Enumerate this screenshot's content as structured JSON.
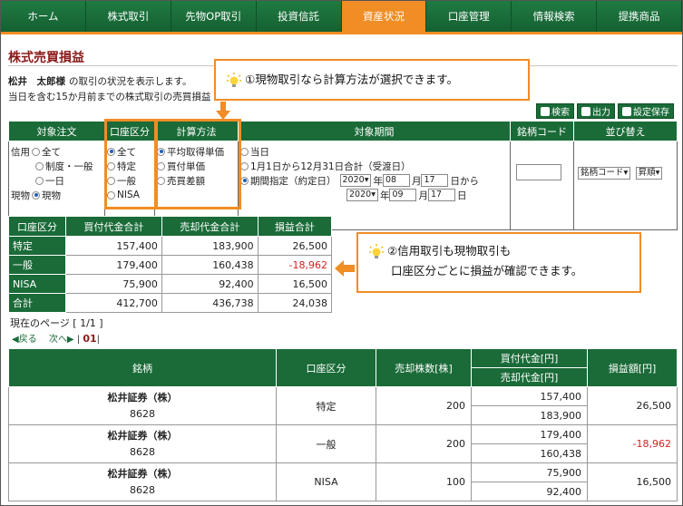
{
  "nav": [
    "ホーム",
    "株式取引",
    "先物OP取引",
    "投資信託",
    "資産状況",
    "口座管理",
    "情報検索",
    "提携商品"
  ],
  "page": {
    "title": "株式売買損益",
    "user": "松井　太郎様",
    "user_suffix": "の取引の状況を表示します。",
    "sub2": "当日を含む15か月前までの株式取引の売買損益"
  },
  "callouts": {
    "c1": "①現物取引なら計算方法が選択できます。",
    "c2_line1": "②信用取引も現物取引も",
    "c2_line2": "口座区分ごとに損益が確認できます。"
  },
  "toolbar": {
    "search": "検索",
    "output": "出力",
    "save": "設定保存"
  },
  "filter": {
    "headers": [
      "対象注文",
      "口座区分",
      "計算方法",
      "対象期間",
      "銘柄コード",
      "並び替え"
    ],
    "order": {
      "credit": "信用",
      "credit_all": "全て",
      "credit_system": "制度・一般",
      "credit_day": "一日",
      "cash": "現物",
      "cash_opt": "現物"
    },
    "account": [
      "全て",
      "特定",
      "一般",
      "NISA"
    ],
    "calc": [
      "平均取得単価",
      "買付単価",
      "売買差額"
    ],
    "period": {
      "today": "当日",
      "year": "1月1日から12月31日合計（受渡日）",
      "range": "期間指定（約定日）",
      "from_year": "2020",
      "from_month": "08",
      "from_day": "17",
      "to_year": "2020",
      "to_month": "09",
      "to_day": "17",
      "nen": "年",
      "tsuki": "月",
      "from_suffix": "日から",
      "to_suffix": "日"
    },
    "code_value": "",
    "sort": {
      "key": "銘柄コード",
      "order": "昇順"
    }
  },
  "summary": {
    "headers": [
      "口座区分",
      "買付代金合計",
      "売却代金合計",
      "損益合計"
    ],
    "rows": [
      [
        "特定",
        "157,400",
        "183,900",
        "26,500"
      ],
      [
        "一般",
        "179,400",
        "160,438",
        "-18,962"
      ],
      [
        "NISA",
        "75,900",
        "92,400",
        "16,500"
      ],
      [
        "合計",
        "412,700",
        "436,738",
        "24,038"
      ]
    ]
  },
  "pager": {
    "current": "現在のページ [ 1/1 ]",
    "prev": "戻る",
    "next": "次へ",
    "page": "01"
  },
  "detail": {
    "headers": {
      "name": "銘柄",
      "account": "口座区分",
      "qty": "売却株数[株]",
      "buy": "買付代金[円]",
      "sell": "売却代金[円]",
      "pl": "損益額[円]"
    },
    "rows": [
      {
        "name": "松井証券（株）",
        "code": "8628",
        "account": "特定",
        "qty": "200",
        "buy": "157,400",
        "sell": "183,900",
        "pl": "26,500"
      },
      {
        "name": "松井証券（株）",
        "code": "8628",
        "account": "一般",
        "qty": "200",
        "buy": "179,400",
        "sell": "160,438",
        "pl": "-18,962"
      },
      {
        "name": "松井証券（株）",
        "code": "8628",
        "account": "NISA",
        "qty": "100",
        "buy": "75,900",
        "sell": "92,400",
        "pl": "16,500"
      }
    ]
  },
  "colors": {
    "nav_green": "#1a6b38",
    "active_orange": "#f08d24",
    "loss_red": "#d42020"
  }
}
